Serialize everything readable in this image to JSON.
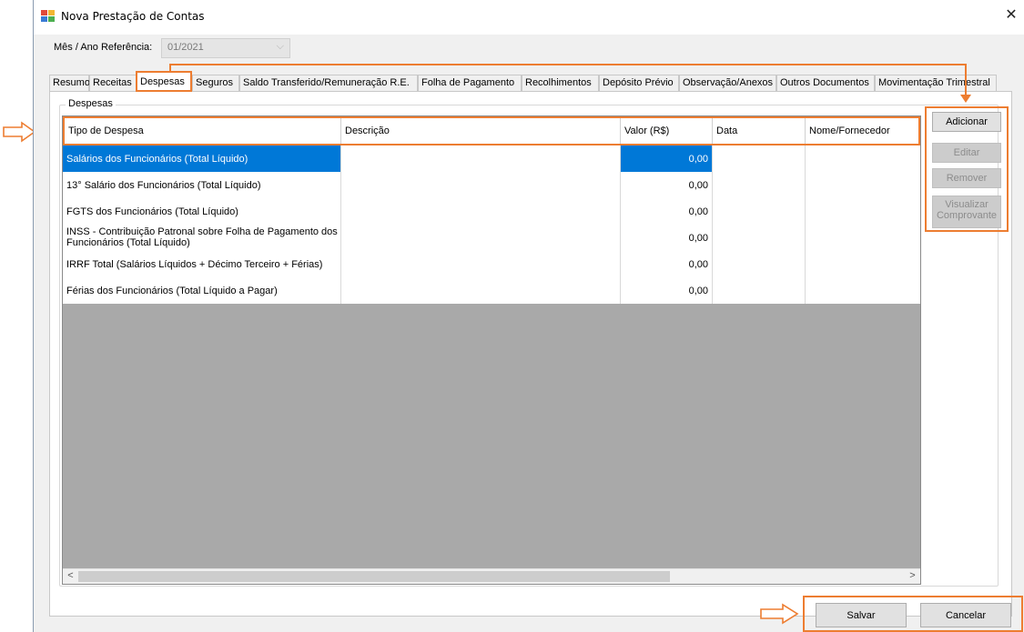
{
  "window": {
    "title": "Nova Prestação de Contas",
    "close_glyph": "✕"
  },
  "reference": {
    "label": "Mês / Ano Referência:",
    "value": "01/2021"
  },
  "tabs": [
    {
      "label": "Resumo"
    },
    {
      "label": "Receitas"
    },
    {
      "label": "Despesas",
      "active": true
    },
    {
      "label": "Seguros"
    },
    {
      "label": "Saldo Transferido/Remuneração R.E."
    },
    {
      "label": "Folha de Pagamento"
    },
    {
      "label": "Recolhimentos"
    },
    {
      "label": "Depósito Prévio"
    },
    {
      "label": "Observação/Anexos"
    },
    {
      "label": "Outros Documentos"
    },
    {
      "label": "Movimentação Trimestral"
    }
  ],
  "group_title": "Despesas",
  "grid": {
    "headers": [
      "Tipo de Despesa",
      "Descrição",
      "Valor (R$)",
      "Data",
      "Nome/Fornecedor"
    ],
    "rows": [
      {
        "tipo": "Salários dos Funcionários (Total Líquido)",
        "descricao": "",
        "valor": "0,00",
        "data": "",
        "fornecedor": "",
        "selected": true
      },
      {
        "tipo": "13° Salário dos Funcionários (Total Líquido)",
        "descricao": "",
        "valor": "0,00",
        "data": "",
        "fornecedor": ""
      },
      {
        "tipo": "FGTS dos Funcionários (Total Líquido)",
        "descricao": "",
        "valor": "0,00",
        "data": "",
        "fornecedor": ""
      },
      {
        "tipo": "INSS - Contribuição Patronal sobre Folha de Pagamento dos Funcionários (Total Líquido)",
        "descricao": "",
        "valor": "0,00",
        "data": "",
        "fornecedor": ""
      },
      {
        "tipo": "IRRF Total (Salários Líquidos + Décimo Terceiro + Férias)",
        "descricao": "",
        "valor": "0,00",
        "data": "",
        "fornecedor": ""
      },
      {
        "tipo": "Férias dos Funcionários (Total Líquido a Pagar)",
        "descricao": "",
        "valor": "0,00",
        "data": "",
        "fornecedor": ""
      }
    ]
  },
  "side_buttons": {
    "add": "Adicionar",
    "edit": "Editar",
    "remove": "Remover",
    "view": "Visualizar Comprovante"
  },
  "footer": {
    "save": "Salvar",
    "cancel": "Cancelar"
  },
  "colors": {
    "annotation": "#ed7d31",
    "selection": "#0078d7",
    "grid_background": "#a9a9a9"
  }
}
